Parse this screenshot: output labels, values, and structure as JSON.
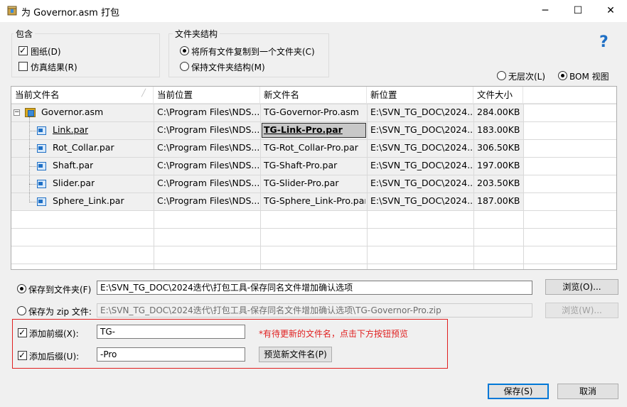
{
  "window": {
    "title": "为 Governor.asm 打包",
    "minimize": "─",
    "maximize": "☐",
    "close": "✕"
  },
  "include_group": {
    "label": "包含",
    "drawings": {
      "label": "图纸(D)",
      "checked": true
    },
    "sim_results": {
      "label": "仿真结果(R)",
      "checked": false
    }
  },
  "folder_group": {
    "label": "文件夹结构",
    "copy_all": {
      "label": "将所有文件复制到一个文件夹(C)",
      "selected": true
    },
    "keep_structure": {
      "label": "保持文件夹结构(M)",
      "selected": false
    }
  },
  "help_icon": "?",
  "view_mode": {
    "flat": {
      "label": "无层次(L)",
      "selected": false
    },
    "bom": {
      "label": "BOM 视图",
      "selected": true
    }
  },
  "table": {
    "headers": [
      "当前文件名",
      "当前位置",
      "新文件名",
      "新位置",
      "文件大小"
    ],
    "sort_indicator": "╱",
    "rows": [
      {
        "name": "Governor.asm",
        "location": "C:\\Program Files\\NDS...",
        "new_name": "TG-Governor-Pro.asm",
        "new_location": "E:\\SVN_TG_DOC\\2024...",
        "size": "284.00KB"
      },
      {
        "name": "Link.par",
        "location": "C:\\Program Files\\NDS...",
        "new_name": "TG-Link-Pro.par",
        "new_location": "E:\\SVN_TG_DOC\\2024...",
        "size": "183.00KB"
      },
      {
        "name": "Rot_Collar.par",
        "location": "C:\\Program Files\\NDS...",
        "new_name": "TG-Rot_Collar-Pro.par",
        "new_location": "E:\\SVN_TG_DOC\\2024...",
        "size": "306.50KB"
      },
      {
        "name": "Shaft.par",
        "location": "C:\\Program Files\\NDS...",
        "new_name": "TG-Shaft-Pro.par",
        "new_location": "E:\\SVN_TG_DOC\\2024...",
        "size": "197.00KB"
      },
      {
        "name": "Slider.par",
        "location": "C:\\Program Files\\NDS...",
        "new_name": "TG-Slider-Pro.par",
        "new_location": "E:\\SVN_TG_DOC\\2024...",
        "size": "203.50KB"
      },
      {
        "name": "Sphere_Link.par",
        "location": "C:\\Program Files\\NDS...",
        "new_name": "TG-Sphere_Link-Pro.par",
        "new_location": "E:\\SVN_TG_DOC\\2024...",
        "size": "187.00KB"
      }
    ]
  },
  "save_folder": {
    "label": "保存到文件夹(F)",
    "selected": true,
    "value": "E:\\SVN_TG_DOC\\2024迭代\\打包工具-保存同名文件增加确认选项",
    "browse": "浏览(O)..."
  },
  "save_zip": {
    "label": "保存为 zip 文件:",
    "selected": false,
    "value": "E:\\SVN_TG_DOC\\2024迭代\\打包工具-保存同名文件增加确认选项\\TG-Governor-Pro.zip",
    "browse": "浏览(W)..."
  },
  "prefix": {
    "label": "添加前缀(X):",
    "checked": true,
    "value": "TG-"
  },
  "suffix": {
    "label": "添加后缀(U):",
    "checked": true,
    "value": "-Pro"
  },
  "hint": "*有待更新的文件名，点击下方按钮预览",
  "preview_button": "预览新文件名(P)",
  "save_button": "保存(S)",
  "cancel_button": "取消",
  "colors": {
    "accent": "#0078d7",
    "hint_red": "#e02020",
    "help_blue": "#1e6fc5"
  }
}
